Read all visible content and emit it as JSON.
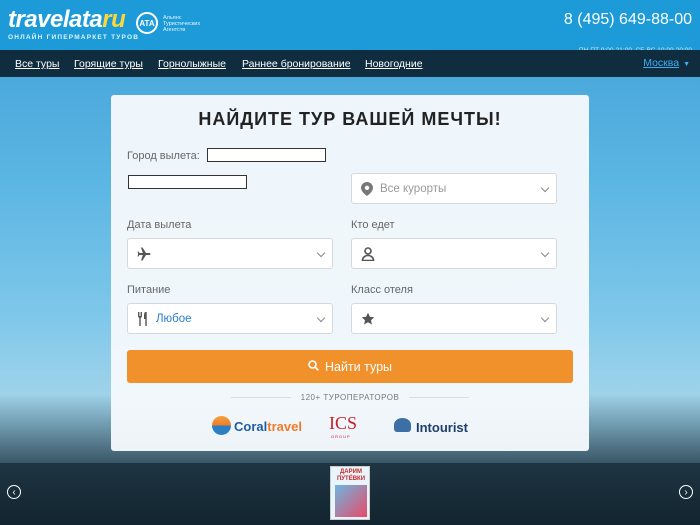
{
  "header": {
    "logo_main": "travelata",
    "logo_ru": "ru",
    "logo_subtitle": "ОНЛАЙН ГИПЕРМАРКЕТ ТУРОВ",
    "ata_badge": "ATA",
    "ata_text": "Альянс Туристических Агентств",
    "phone": "8 (495) 649-88-00",
    "hours": "ПН-ПТ 9:00-21:00, СБ-ВС 10:00-20:00"
  },
  "nav": {
    "items": [
      "Все туры",
      "Горящие туры",
      "Горнолыжные",
      "Раннее бронирование",
      "Новогодние"
    ],
    "city": "Москва"
  },
  "form": {
    "title": "НАЙДИТЕ ТУР ВАШЕЙ МЕЧТЫ!",
    "departure_city_label": "Город вылета:",
    "departure_city_value": "",
    "country_value": "",
    "resorts_placeholder": "Все курорты",
    "date_label": "Дата вылета",
    "date_value": "",
    "travelers_label": "Кто едет",
    "travelers_value": "",
    "meal_label": "Питание",
    "meal_value": "Любое",
    "hotel_class_label": "Класс отеля",
    "hotel_class_value": "",
    "search_button": "Найти туры"
  },
  "operators": {
    "label": "120+ ТУРОПЕРАТОРОВ",
    "coral_a": "Coral",
    "coral_b": "travel",
    "ics": "ICS",
    "ics_sub": "GROUP",
    "intourist": "Intourist"
  },
  "promo": {
    "title": "ДАРИМ ПУТЁВКИ"
  },
  "colors": {
    "header_blue": "#1c9bd8",
    "nav_dark": "#0f2d3f",
    "button_orange": "#f0912c",
    "meal_value": "#2a7fcf"
  }
}
